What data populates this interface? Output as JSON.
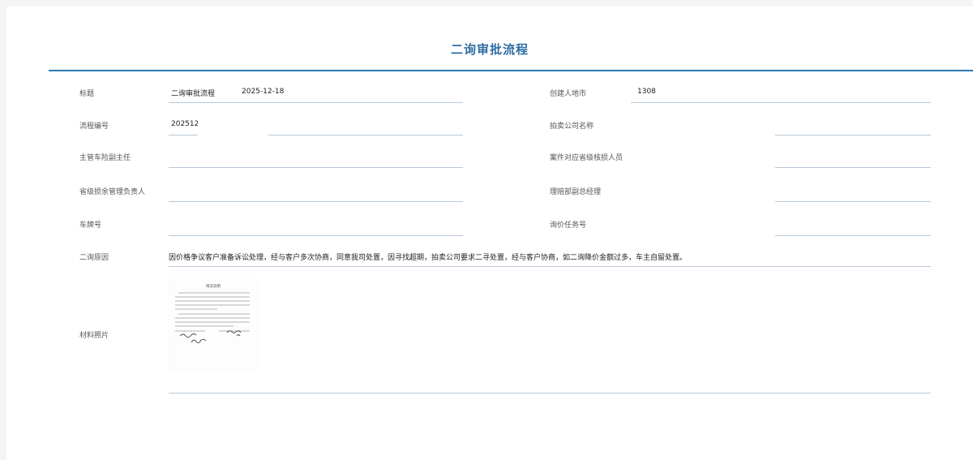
{
  "page": {
    "title": "二询审批流程"
  },
  "fields": {
    "title_label": "标题",
    "title_value": "二询审批流程",
    "title_date": "2025-12-18",
    "creator_city_label": "创建人地市",
    "creator_city_value": "1308",
    "process_no_label": "流程编号",
    "process_no_value": "202512",
    "auction_company_label": "拍卖公司名称",
    "auction_company_value": "",
    "supervisor_label": "主管车险副主任",
    "supervisor_value": "",
    "provincial_assessor_label": "案件对应省级核损人员",
    "provincial_assessor_value": "",
    "provincial_salvage_label": "省级损余管理负责人",
    "provincial_salvage_value": "",
    "claims_deputy_label": "理赔部副总经理",
    "claims_deputy_value": "",
    "plate_no_label": "车牌号",
    "plate_no_value": "",
    "inquiry_task_label": "询价任务号",
    "inquiry_task_value": "",
    "reason_label": "二询原因",
    "reason_value": "因价格争议客户准备诉讼处理，经与客户多次协商，同意我司处置，因寻找超期，拍卖公司要求二寻处置，经与客户协商，如二询降价金额过多，车主自留处置。",
    "photo_label": "材料照片"
  },
  "photo_doc": {
    "heading": "情况说明"
  }
}
